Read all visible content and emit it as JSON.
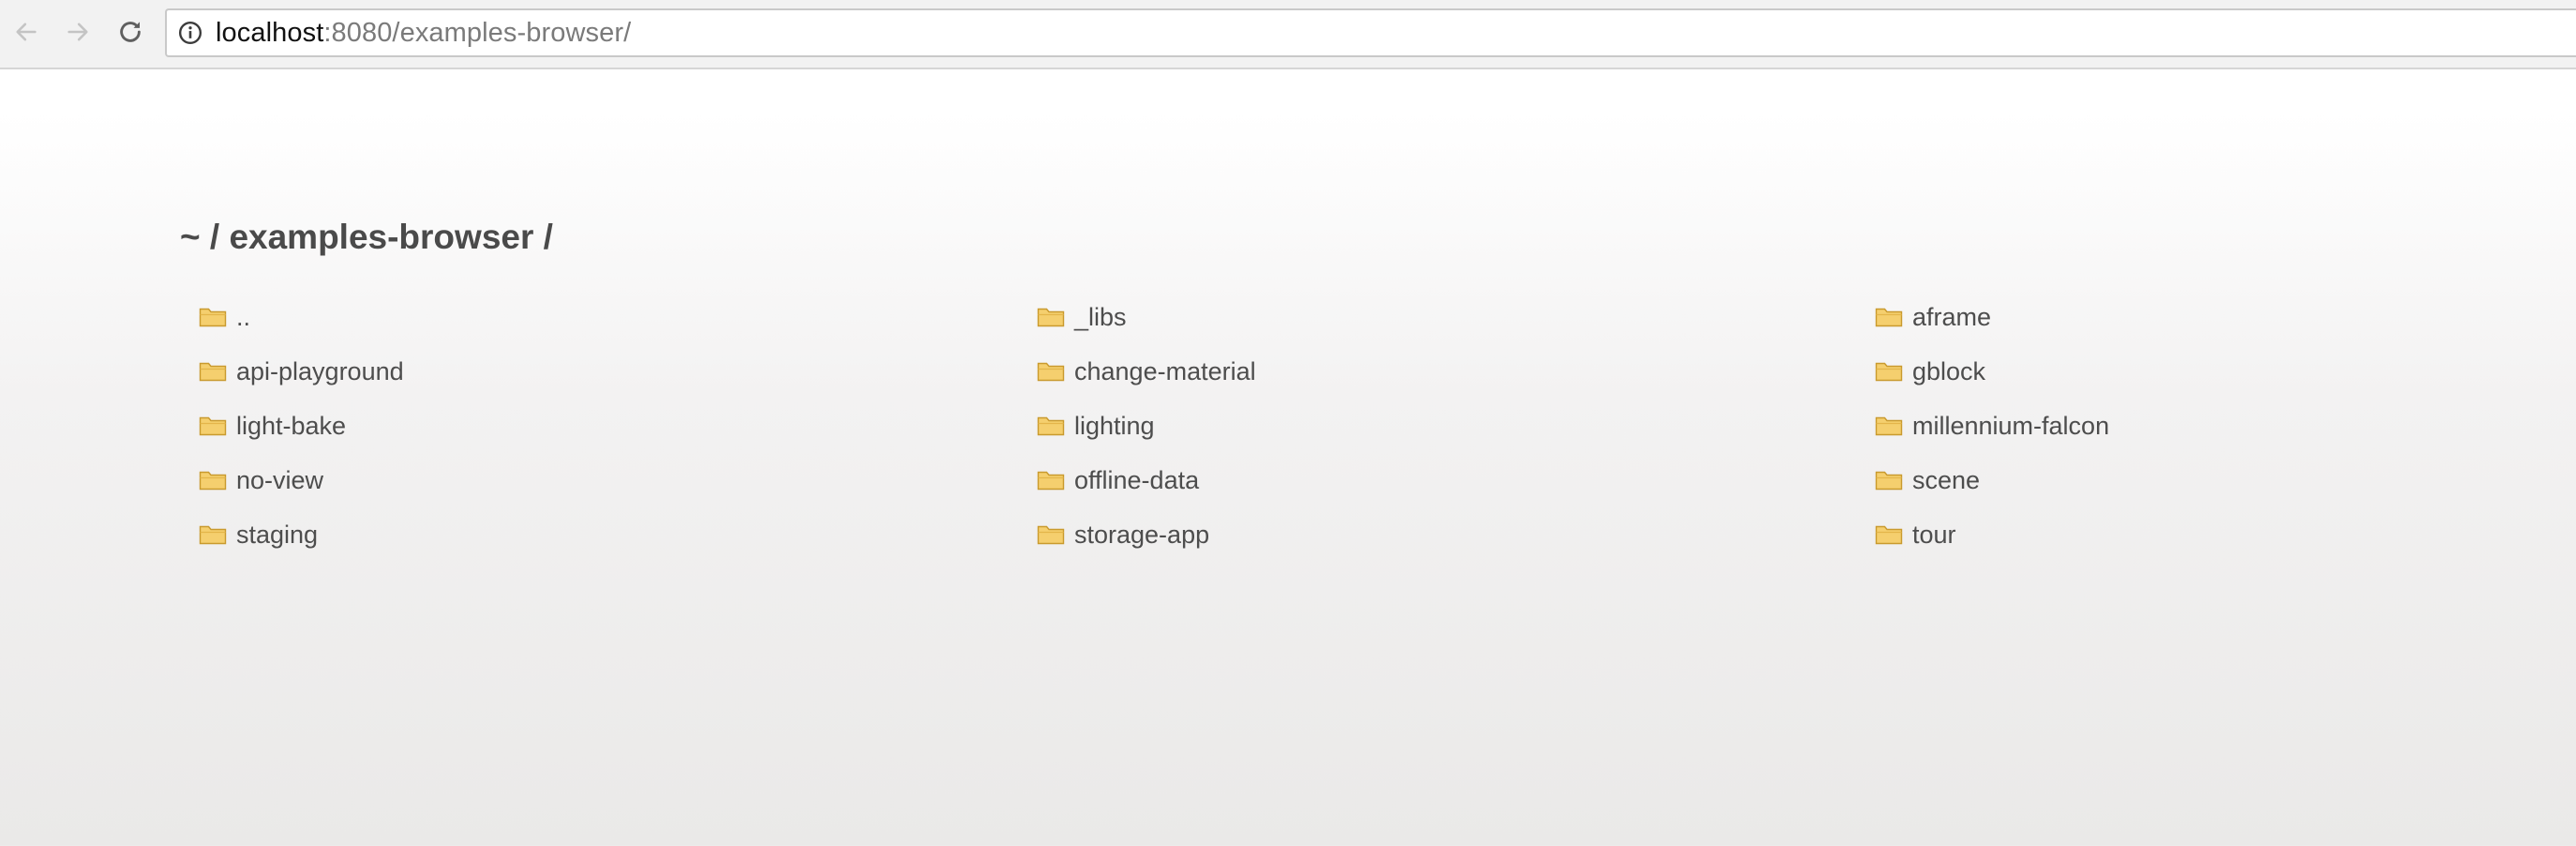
{
  "browser": {
    "url_host": "localhost",
    "url_rest": ":8080/examples-browser/"
  },
  "page": {
    "heading": "~ / examples-browser /",
    "entries": [
      [
        "..",
        "_libs",
        "aframe"
      ],
      [
        "api-playground",
        "change-material",
        "gblock"
      ],
      [
        "light-bake",
        "lighting",
        "millennium-falcon"
      ],
      [
        "no-view",
        "offline-data",
        "scene"
      ],
      [
        "staging",
        "storage-app",
        "tour"
      ]
    ]
  },
  "icons": {
    "back": "arrow-left-icon",
    "forward": "arrow-right-icon",
    "reload": "reload-icon",
    "info": "info-icon",
    "entry": "folder-icon"
  },
  "colors": {
    "folder_body": "#f5cf6e",
    "folder_edge": "#c99a2e",
    "link_text": "#4d4d4d",
    "heading_text": "#4a4a4a"
  }
}
